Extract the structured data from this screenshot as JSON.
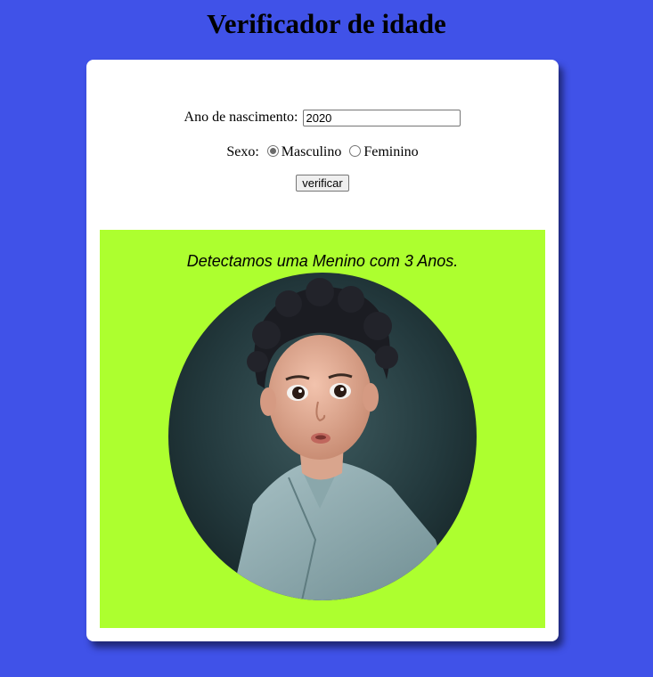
{
  "title": "Verificador de idade",
  "form": {
    "year_label": "Ano de nascimento:",
    "year_value": "2020",
    "sex_label": "Sexo:",
    "options": [
      {
        "label": "Masculino",
        "checked": true
      },
      {
        "label": "Feminino",
        "checked": false
      }
    ],
    "button_label": "verificar"
  },
  "result": {
    "message": "Detectamos uma Menino com 3 Anos.",
    "background": "#adff2f",
    "image": "child-photo"
  },
  "colors": {
    "page_background": "#4052e8",
    "card": "#ffffff"
  }
}
